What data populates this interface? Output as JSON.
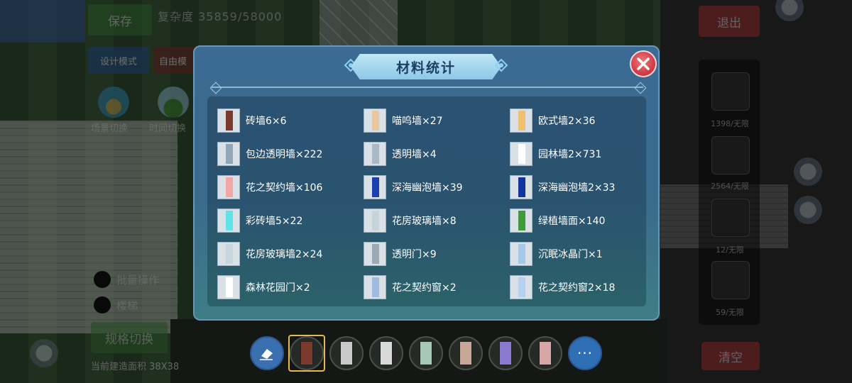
{
  "hud": {
    "save_label": "保存",
    "complexity_text": "复杂度 35859/58000",
    "design_mode_label": "设计模式",
    "free_mode_label": "自由模",
    "exit_label": "退出",
    "clear_label": "清空",
    "scene_switch_label": "场景切换",
    "time_switch_label": "时间切换",
    "batch_label": "批量操作",
    "stairs_label": "楼梯",
    "spec_switch_label": "规格切换",
    "area_label": "当前建造面积 38X38",
    "side_counts": [
      "1398/无限",
      "2564/无限",
      "12/无限",
      "59/无限"
    ],
    "more_label": "···"
  },
  "dialog": {
    "title": "材料统计",
    "items": [
      {
        "label": "砖墙6×6",
        "icon": "brick-wall-icon",
        "color": "#7a3a2e"
      },
      {
        "label": "喵呜墙×27",
        "icon": "meow-wall-icon",
        "color": "#e9c8a0"
      },
      {
        "label": "欧式墙2×36",
        "icon": "euro-wall-icon",
        "color": "#f0c070"
      },
      {
        "label": "包边透明墙×222",
        "icon": "edged-glass-wall-icon",
        "color": "#8fa7b8"
      },
      {
        "label": "透明墙×4",
        "icon": "glass-wall-icon",
        "color": "#a9bac6"
      },
      {
        "label": "园林墙2×731",
        "icon": "garden-wall-icon",
        "color": "#ffffff"
      },
      {
        "label": "花之契约墙×106",
        "icon": "flower-pact-wall-icon",
        "color": "#f2a6a6"
      },
      {
        "label": "深海幽泡墙×39",
        "icon": "deep-sea-wall-icon",
        "color": "#1a3fb0"
      },
      {
        "label": "深海幽泡墙2×33",
        "icon": "deep-sea-wall-2-icon",
        "color": "#1234a0"
      },
      {
        "label": "彩砖墙5×22",
        "icon": "color-brick-wall-icon",
        "color": "#5fe3e6"
      },
      {
        "label": "花房玻璃墙×8",
        "icon": "greenhouse-glass-wall-icon",
        "color": "#c5d3db"
      },
      {
        "label": "绿植墙面×140",
        "icon": "green-plant-wall-icon",
        "color": "#3f9a3a"
      },
      {
        "label": "花房玻璃墙2×24",
        "icon": "greenhouse-glass-wall-2-icon",
        "color": "#c7d5de"
      },
      {
        "label": "透明门×9",
        "icon": "glass-door-icon",
        "color": "#9aa9b4"
      },
      {
        "label": "沉眠冰晶门×1",
        "icon": "ice-crystal-door-icon",
        "color": "#a8c8ea"
      },
      {
        "label": "森林花园门×2",
        "icon": "forest-garden-door-icon",
        "color": "#ffffff"
      },
      {
        "label": "花之契约窗×2",
        "icon": "flower-pact-window-icon",
        "color": "#9fbbe0"
      },
      {
        "label": "花之契约窗2×18",
        "icon": "flower-pact-window-2-icon",
        "color": "#b6d0ee"
      }
    ]
  }
}
